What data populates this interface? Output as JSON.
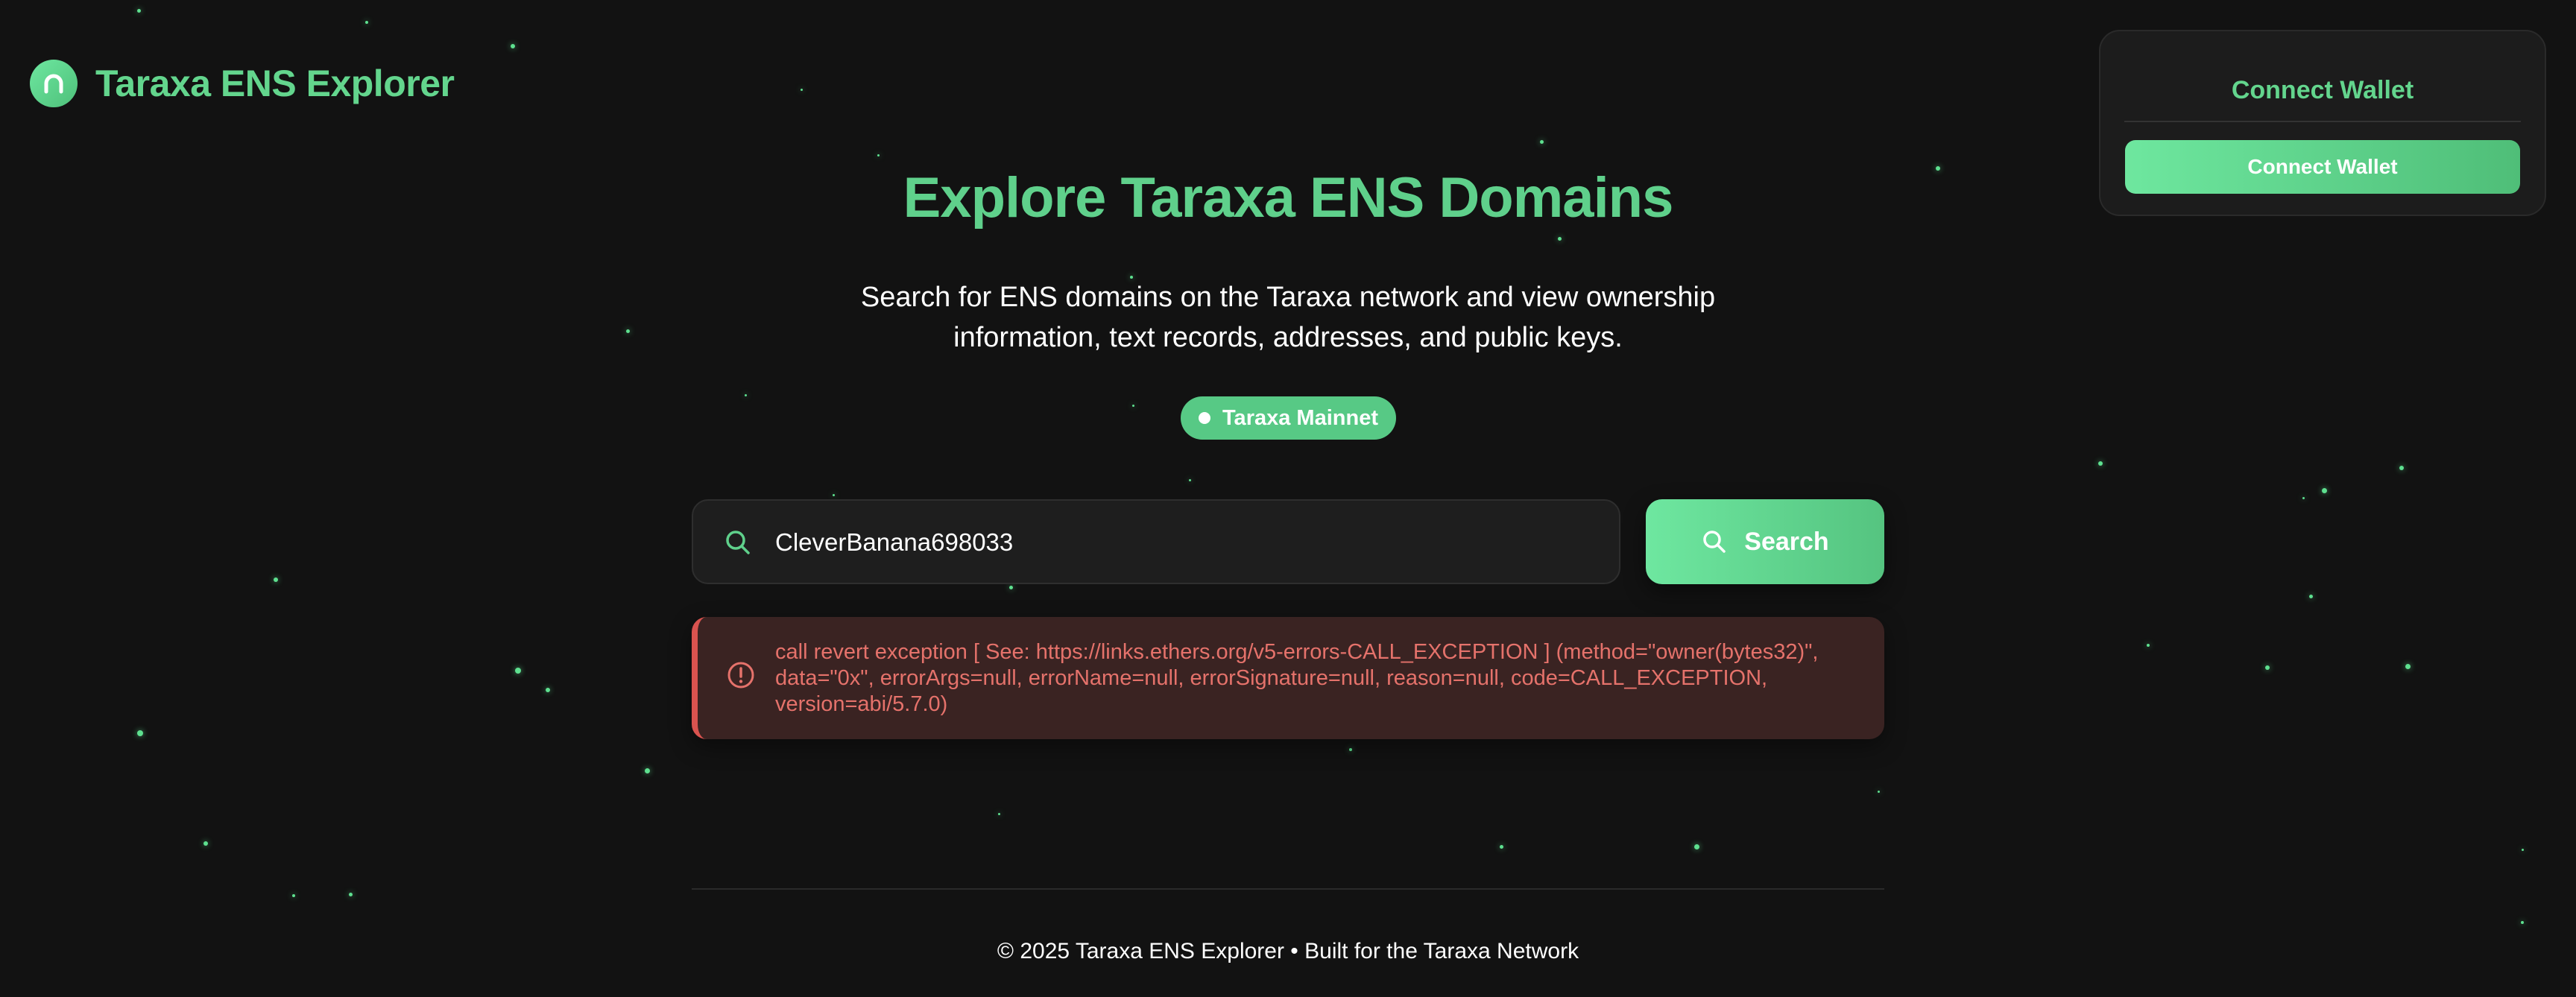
{
  "header": {
    "logo_icon": "arch-icon",
    "title": "Taraxa ENS Explorer"
  },
  "wallet": {
    "title": "Connect Wallet",
    "button_label": "Connect Wallet"
  },
  "hero": {
    "title": "Explore Taraxa ENS Domains",
    "subtitle_line1": "Search for ENS domains on the Taraxa network and view ownership",
    "subtitle_line2": "information, text records, addresses, and public keys."
  },
  "network_badge": {
    "label": "Taraxa Mainnet"
  },
  "search": {
    "value": "CleverBanana698033",
    "button_label": "Search",
    "icon": "search-icon"
  },
  "error": {
    "icon": "alert-circle-icon",
    "message": "call revert exception [ See: https://links.ethers.org/v5-errors-CALL_EXCEPTION ] (method=\"owner(bytes32)\", data=\"0x\", errorArgs=null, errorName=null, errorSignature=null, reason=null, code=CALL_EXCEPTION, version=abi/5.7.0)"
  },
  "footer": {
    "text": "© 2025 Taraxa ENS Explorer • Built for the Taraxa Network"
  },
  "colors": {
    "background": "#121212",
    "accent": "#63d58d",
    "error": "#e5726b",
    "error_bg": "#3a2322"
  }
}
